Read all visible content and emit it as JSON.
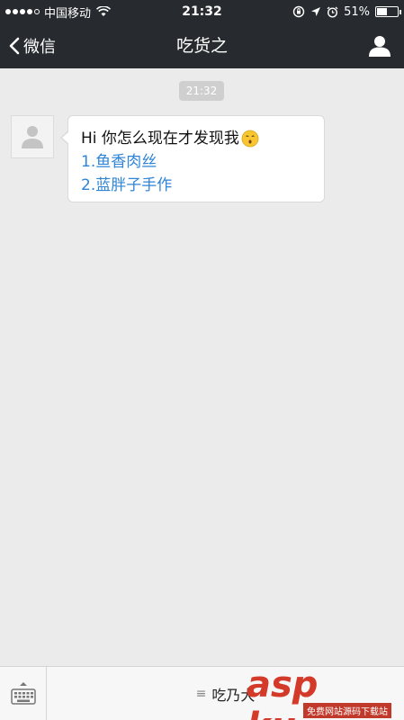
{
  "status_bar": {
    "carrier": "中国移动",
    "time": "21:32",
    "battery": "51%",
    "battery_level": 0.51
  },
  "nav": {
    "back_label": "微信",
    "title": "吃货之"
  },
  "chat": {
    "timestamp": "21:32",
    "message": {
      "text": "Hi 你怎么现在才发现我",
      "links": [
        "1.鱼香肉丝",
        "2.蓝胖子手作"
      ]
    }
  },
  "bottom_bar": {
    "menu_label": "吃乃大"
  },
  "watermark": {
    "text": "asp ku",
    "subtext": "免费网站源码下载站"
  },
  "icons": {
    "back": "chevron-left-icon",
    "profile": "person-icon",
    "avatar": "default-avatar-icon",
    "emoji": "kissing-face-emoji",
    "keyboard": "keyboard-icon",
    "menu": "menu-lines-icon",
    "wifi": "wifi-icon",
    "location": "location-arrow-icon",
    "alarm": "alarm-icon",
    "lock_rotation": "rotation-lock-icon"
  },
  "colors": {
    "nav_background": "#272a2e",
    "chat_background": "#ebebeb",
    "link": "#2e84d6"
  }
}
